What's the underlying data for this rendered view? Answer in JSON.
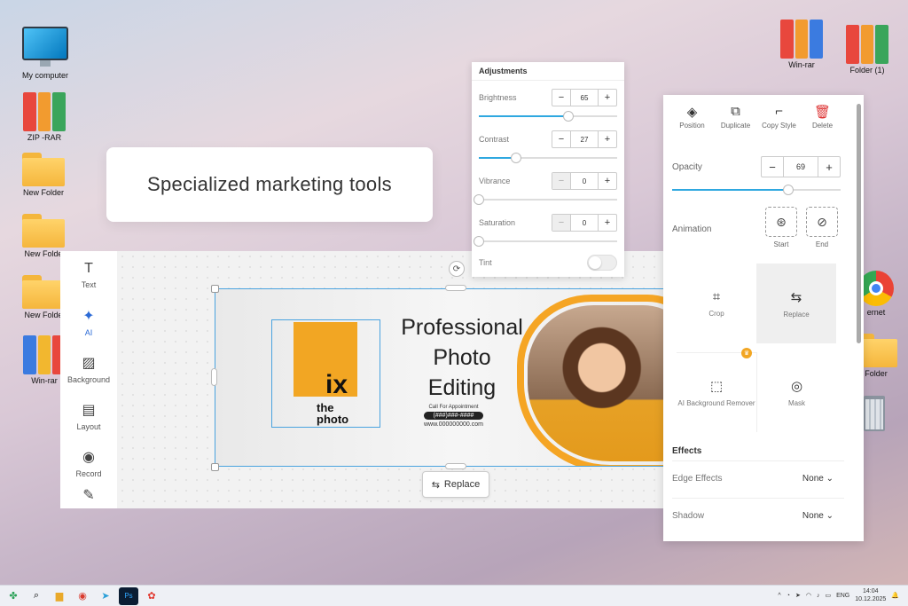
{
  "desktop": {
    "left_icons": [
      {
        "label": "My computer",
        "kind": "monitor"
      },
      {
        "label": "ZIP -RAR",
        "kind": "binders"
      },
      {
        "label": "New Folder",
        "kind": "folder"
      },
      {
        "label": "New Folde",
        "kind": "folder"
      },
      {
        "label": "New Folde",
        "kind": "folder"
      },
      {
        "label": "Win-rar",
        "kind": "binders"
      }
    ],
    "right_icons": [
      {
        "label": "Win-rar",
        "kind": "binders"
      },
      {
        "label": "Folder (1)",
        "kind": "binders"
      },
      {
        "label": "ernet",
        "kind": "chrome"
      },
      {
        "label": "Folder",
        "kind": "folder"
      },
      {
        "label": "",
        "kind": "trash"
      }
    ]
  },
  "promo": {
    "text": "Specialized marketing tools"
  },
  "toolbar": {
    "items": [
      {
        "label": "Text",
        "icon": "text-icon",
        "glyph": "T"
      },
      {
        "label": "AI",
        "icon": "sparkle-icon",
        "glyph": "✦"
      },
      {
        "label": "Background",
        "icon": "background-icon",
        "glyph": "▨"
      },
      {
        "label": "Layout",
        "icon": "layout-icon",
        "glyph": "▤"
      },
      {
        "label": "Record",
        "icon": "record-icon",
        "glyph": "◉"
      },
      {
        "label": "",
        "icon": "pen-icon",
        "glyph": "✎"
      }
    ]
  },
  "banner": {
    "logo_fix": "ix",
    "logo_the": "the",
    "logo_photo": "photo",
    "headline": [
      "Professional",
      "Photo",
      "Editing"
    ],
    "call_label": "Call For Appointment",
    "phone": "(###)###-####",
    "website": "www.000000000.com"
  },
  "replace_button": {
    "label": "Replace"
  },
  "adjustments": {
    "title": "Adjustments",
    "sliders": [
      {
        "label": "Brightness",
        "value": "65",
        "percent": 65,
        "minus_disabled": false
      },
      {
        "label": "Contrast",
        "value": "27",
        "percent": 27,
        "minus_disabled": false
      },
      {
        "label": "Vibrance",
        "value": "0",
        "percent": 0,
        "minus_disabled": true
      },
      {
        "label": "Saturation",
        "value": "0",
        "percent": 0,
        "minus_disabled": true
      }
    ],
    "tint_label": "Tint",
    "tint_on": false
  },
  "properties": {
    "actions": [
      {
        "label": "Position",
        "icon": "layers-icon",
        "glyph": "◈"
      },
      {
        "label": "Duplicate",
        "icon": "duplicate-icon",
        "glyph": "⧉"
      },
      {
        "label": "Copy Style",
        "icon": "paint-roller-icon",
        "glyph": "⌐"
      },
      {
        "label": "Delete",
        "icon": "trash-icon",
        "glyph": "🗑"
      }
    ],
    "opacity_label": "Opacity",
    "opacity_value": "69",
    "opacity_percent": 69,
    "animation_label": "Animation",
    "animation_start": "Start",
    "animation_end": "End",
    "cells": [
      {
        "label": "Crop",
        "icon": "crop-icon",
        "glyph": "⌗"
      },
      {
        "label": "Replace",
        "icon": "replace-icon",
        "glyph": "⇆"
      },
      {
        "label": "AI Background Remover",
        "icon": "ai-background-icon",
        "glyph": "⬚"
      },
      {
        "label": "Mask",
        "icon": "mask-icon",
        "glyph": "◎"
      }
    ],
    "effects_title": "Effects",
    "edge_effects_label": "Edge Effects",
    "edge_effects_value": "None",
    "shadow_label": "Shadow",
    "shadow_value": "None"
  },
  "taskbar": {
    "lang": "ENG",
    "time": "14:04",
    "date": "10.12.2025"
  }
}
